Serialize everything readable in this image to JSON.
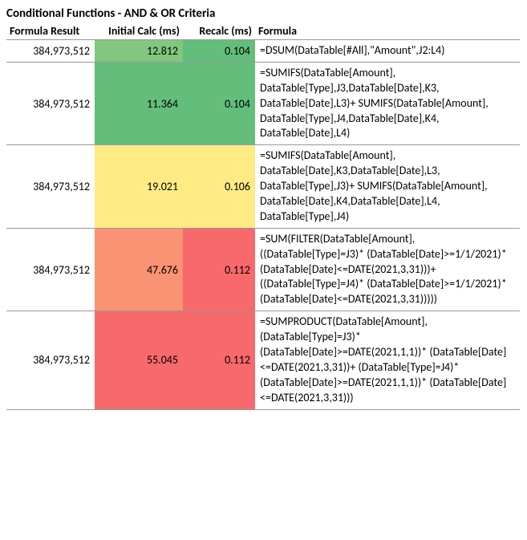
{
  "title": "Conditional Functions - AND & OR Criteria",
  "headers": {
    "result": "Formula Result",
    "initial": "Initial Calc (ms)",
    "recalc": "Recalc (ms)",
    "formula": "Formula"
  },
  "colors": {
    "green_dark": "#63BE7B",
    "green_mid": "#82C77D",
    "green_light": "#A3D07F",
    "yellow": "#FFEB84",
    "pink": "#FCBF7B",
    "salmon": "#FA9373",
    "coral": "#F8696B"
  },
  "rows": [
    {
      "result": "384,973,512",
      "initial": "12.812",
      "recalc": "0.104",
      "formula": "=DSUM(DataTable[#All],\"Amount\",J2:L4)",
      "initial_color": "green_mid",
      "recalc_color": "green_dark"
    },
    {
      "result": "384,973,512",
      "initial": "11.364",
      "recalc": "0.104",
      "formula": "=SUMIFS(DataTable[Amount], DataTable[Type],J3,DataTable[Date],K3, DataTable[Date],L3)+ SUMIFS(DataTable[Amount], DataTable[Type],J4,DataTable[Date],K4, DataTable[Date],L4)",
      "initial_color": "green_dark",
      "recalc_color": "green_dark"
    },
    {
      "result": "384,973,512",
      "initial": "19.021",
      "recalc": "0.106",
      "formula": "=SUMIFS(DataTable[Amount], DataTable[Date],K3,DataTable[Date],L3, DataTable[Type],J3)+ SUMIFS(DataTable[Amount], DataTable[Date],K4,DataTable[Date],L4, DataTable[Type],J4)",
      "initial_color": "yellow",
      "recalc_color": "yellow"
    },
    {
      "result": "384,973,512",
      "initial": "47.676",
      "recalc": "0.112",
      "formula": "=SUM(FILTER(DataTable[Amount], ((DataTable[Type]=J3)* (DataTable[Date]>=1/1/2021)* (DataTable[Date]<=DATE(2021,3,31)))+ ((DataTable[Type]=J4)* (DataTable[Date]>=1/1/2021)* (DataTable[Date]<=DATE(2021,3,31)))))",
      "initial_color": "salmon",
      "recalc_color": "coral"
    },
    {
      "result": "384,973,512",
      "initial": "55.045",
      "recalc": "0.112",
      "formula": "=SUMPRODUCT(DataTable[Amount], (DataTable[Type]=J3)* (DataTable[Date]>=DATE(2021,1,1))* (DataTable[Date]<=DATE(2021,3,31))+ (DataTable[Type]=J4)* (DataTable[Date]>=DATE(2021,1,1))* (DataTable[Date]<=DATE(2021,3,31)))",
      "initial_color": "coral",
      "recalc_color": "coral"
    }
  ]
}
